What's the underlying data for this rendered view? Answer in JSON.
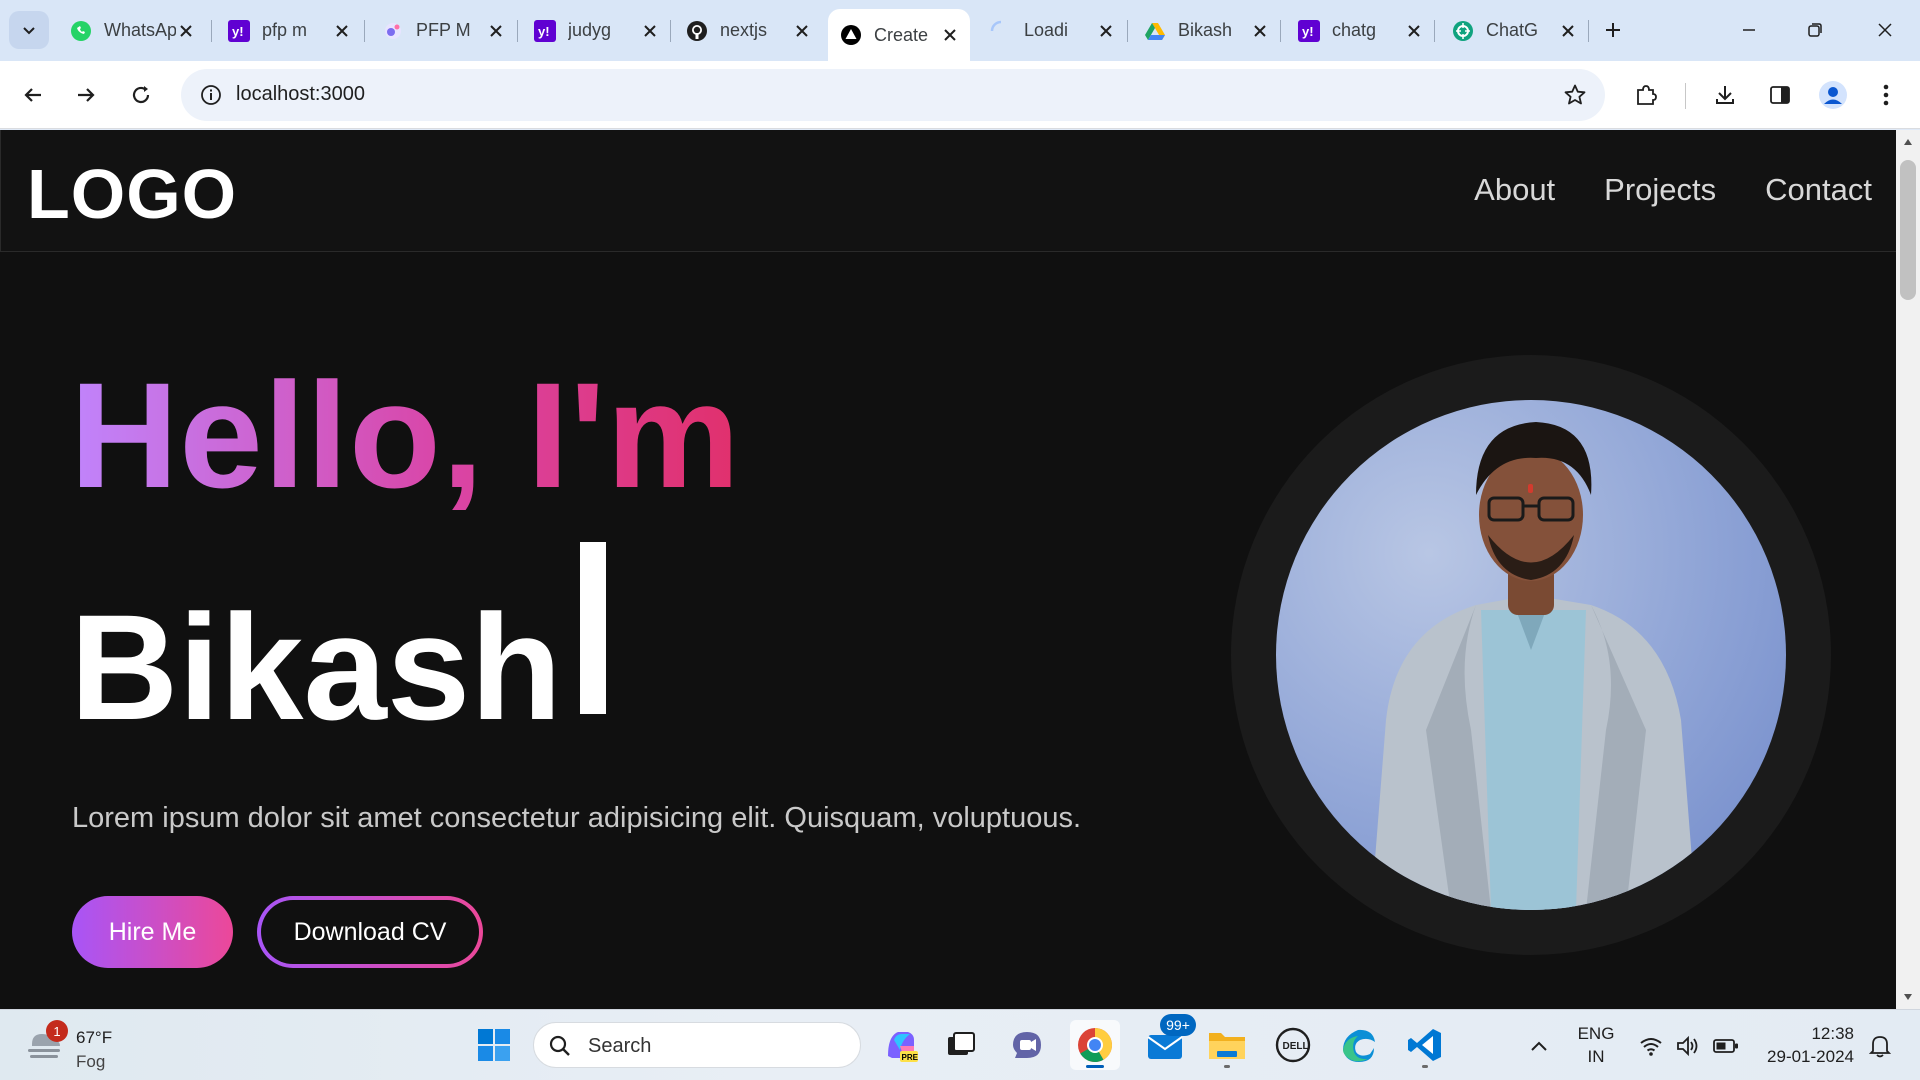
{
  "browser": {
    "tabs": [
      {
        "title": "WhatsApp",
        "icon": "whatsapp-icon",
        "color": "#25d366"
      },
      {
        "title": "pfp m",
        "icon": "yahoo-icon",
        "color": "#6001d2"
      },
      {
        "title": "PFP M",
        "icon": "pfp-maker-icon",
        "color": "#7c6cf0"
      },
      {
        "title": "judyg",
        "icon": "yahoo-icon",
        "color": "#6001d2"
      },
      {
        "title": "nextjs",
        "icon": "github-icon",
        "color": "#1f1f1f"
      },
      {
        "title": "Create",
        "icon": "nextjs-triangle-icon",
        "color": "#000000",
        "active": true
      },
      {
        "title": "Loadi",
        "icon": "loading-spinner-icon",
        "color": "#a8c7fa"
      },
      {
        "title": "Bikash",
        "icon": "google-drive-icon",
        "color": "#1fa463"
      },
      {
        "title": "chatg",
        "icon": "yahoo-icon",
        "color": "#6001d2"
      },
      {
        "title": "ChatG",
        "icon": "chatgpt-icon",
        "color": "#10a37f"
      }
    ],
    "url": "localhost:3000"
  },
  "site": {
    "logo": "LOGO",
    "nav": [
      "About",
      "Projects",
      "Contact"
    ],
    "greeting": "Hello, I'm",
    "name": "Bikash",
    "description": "Lorem ipsum dolor sit amet consectetur adipisicing elit. Quisquam, voluptuous.",
    "hire_label": "Hire Me",
    "cv_label": "Download CV",
    "accent_from": "#a855f7",
    "accent_to": "#ec4899"
  },
  "taskbar": {
    "weather_temp": "67°F",
    "weather_desc": "Fog",
    "weather_badge": "1",
    "search_placeholder": "Search",
    "mail_badge": "99+",
    "lang_line1": "ENG",
    "lang_line2": "IN",
    "time": "12:38",
    "date": "29-01-2024"
  }
}
